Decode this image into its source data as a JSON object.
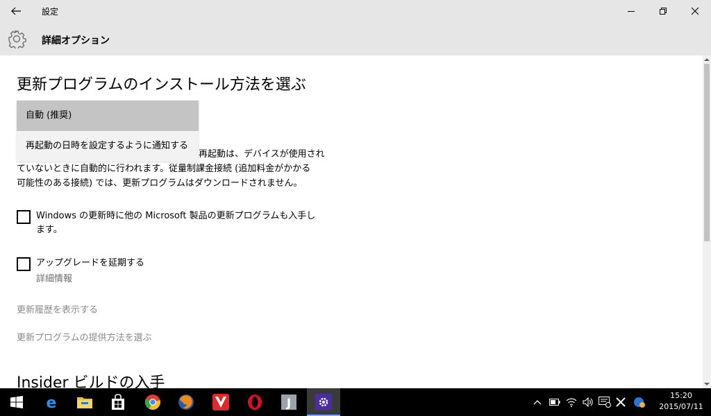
{
  "window": {
    "title": "設定"
  },
  "header": {
    "title": "詳細オプション",
    "icon": "gear-icon"
  },
  "install_section": {
    "heading": "更新プログラムのインストール方法を選ぶ",
    "dropdown_options": [
      "自動 (推奨)",
      "再起動の日時を設定するように通知する"
    ],
    "selected_option": "自動 (推奨)",
    "description_lines": [
      "再起動は、デバイスが使用され",
      "ていないときに自動的に行われます。従量制課金接続 (追加料金がかかる",
      "可能性のある接続) では、更新プログラムはダウンロードされません。"
    ]
  },
  "options": {
    "microsoft_updates": {
      "label_lines": [
        "Windows の更新時に他の Microsoft 製品の更新プログラムも入手し",
        "ます。"
      ],
      "checked": false
    },
    "defer_upgrades": {
      "label": "アップグレードを延期する",
      "checked": false,
      "sub_label": "詳細情報"
    }
  },
  "links": {
    "view_history": "更新履歴を表示する",
    "choose_delivery": "更新プログラムの提供方法を選ぶ"
  },
  "insider_section": {
    "heading": "Insider ビルドの入手"
  },
  "taskbar": {
    "apps": [
      "start-icon",
      "edge-icon",
      "file-explorer-icon",
      "store-icon",
      "chrome-icon",
      "firefox-icon",
      "vivaldi-icon",
      "opera-icon",
      "j-app-icon",
      "settings-icon"
    ],
    "active_app": "settings-icon",
    "clock": {
      "time": "15:20",
      "date": "2015/07/11"
    }
  },
  "colors": {
    "title_bar": "#e6e6e6",
    "selected_option": "#c4c4c4",
    "link": "#8a8a8a",
    "taskbar": "#000000",
    "settings_tile": "#4b2e9e"
  }
}
